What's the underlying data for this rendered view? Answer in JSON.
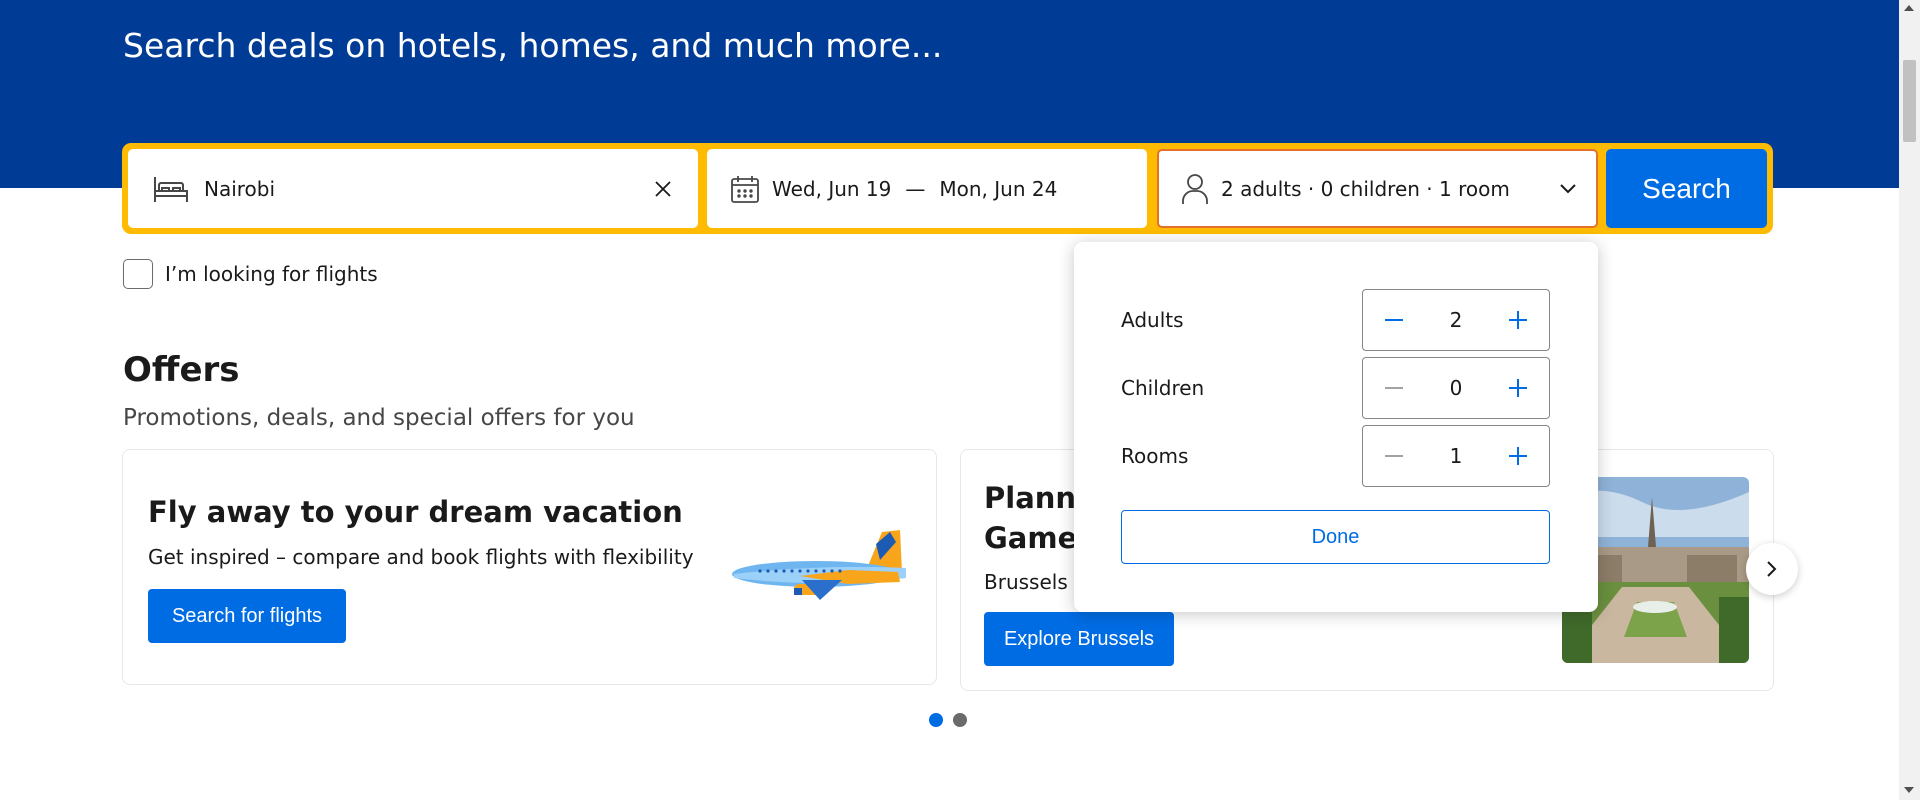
{
  "hero": {
    "subtitle": "Search deals on hotels, homes, and much more..."
  },
  "search": {
    "destination": "Nairobi",
    "checkin": "Wed, Jun 19",
    "date_separator": "—",
    "checkout": "Mon, Jun 24",
    "occupancy": "2 adults · 0 children · 1 room",
    "button_label": "Search"
  },
  "flights_option": {
    "label": "I’m looking for flights",
    "checked": false
  },
  "offers": {
    "title": "Offers",
    "subtitle": "Promotions, deals, and special offers for you",
    "cards": [
      {
        "title": "Fly away to your dream vacation",
        "text": "Get inspired – compare and book flights with flexibility",
        "button": "Search for flights"
      },
      {
        "title_line1": "Planni",
        "title_line2": "Games",
        "text": "Brussels is",
        "button": "Explore Brussels"
      }
    ],
    "carousel": {
      "total": 2,
      "active": 1
    }
  },
  "occupancy_popup": {
    "rows": [
      {
        "label": "Adults",
        "value": "2"
      },
      {
        "label": "Children",
        "value": "0"
      },
      {
        "label": "Rooms",
        "value": "1"
      }
    ],
    "done_label": "Done"
  },
  "colors": {
    "brand_blue": "#003b95",
    "action_blue": "#006ce4",
    "search_border": "#febb02",
    "focus_border": "#e4702b"
  },
  "icons": [
    "bed-icon",
    "clear-icon",
    "calendar-icon",
    "person-icon",
    "chevron-down-icon",
    "minus-icon",
    "plus-icon",
    "chevron-right-icon"
  ]
}
